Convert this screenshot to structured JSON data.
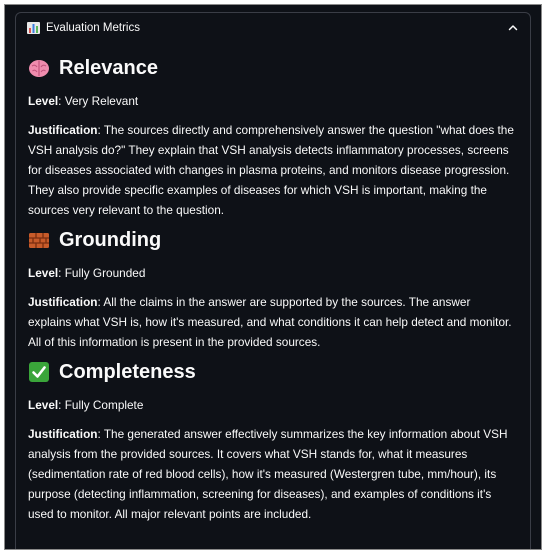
{
  "panel": {
    "title": "Evaluation Metrics",
    "icon": "bar-chart-icon",
    "toggle_icon": "chevron-up-icon"
  },
  "sections": [
    {
      "icon": "brain-icon",
      "title": "Relevance",
      "level_label": "Level",
      "level_value": ": Very Relevant",
      "justification_label": "Justification",
      "justification_text": ": The sources directly and comprehensively answer the question \"what does the VSH analysis do?\" They explain that VSH analysis detects inflammatory processes, screens for diseases associated with changes in plasma proteins, and monitors disease progression. They also provide specific examples of diseases for which VSH is important, making the sources very relevant to the question."
    },
    {
      "icon": "bricks-icon",
      "title": "Grounding",
      "level_label": "Level",
      "level_value": ": Fully Grounded",
      "justification_label": "Justification",
      "justification_text": ": All the claims in the answer are supported by the sources. The answer explains what VSH is, how it's measured, and what conditions it can help detect and monitor. All of this information is present in the provided sources."
    },
    {
      "icon": "check-mark-icon",
      "title": "Completeness",
      "level_label": "Level",
      "level_value": ": Fully Complete",
      "justification_label": "Justification",
      "justification_text": ": The generated answer effectively summarizes the key information about VSH analysis from the provided sources. It covers what VSH stands for, what it measures (sedimentation rate of red blood cells), how it's measured (Westergren tube, mm/hour), its purpose (detecting inflammation, screening for diseases), and examples of conditions it's used to monitor. All major relevant points are included."
    }
  ]
}
